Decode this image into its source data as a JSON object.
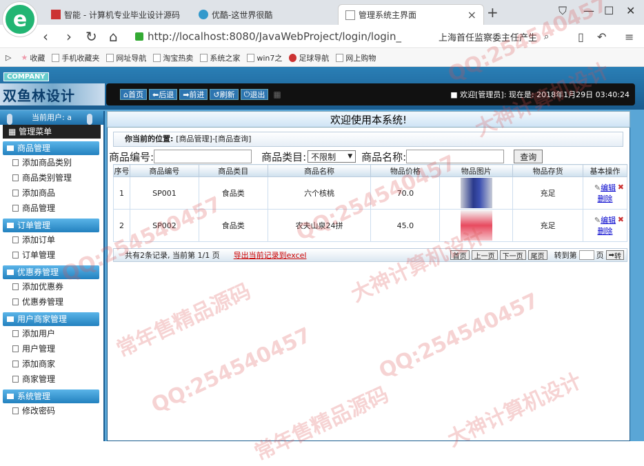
{
  "browser": {
    "tabs": [
      {
        "title": "智能 - 计算机专业毕业设计源码"
      },
      {
        "title": "优酷-这世界很酷"
      },
      {
        "title": "管理系统主界面"
      }
    ],
    "url": "http://localhost:8080/JavaWebProject/login/login_",
    "search_text": "上海首任监察委主任产生",
    "bookmarks": [
      "收藏",
      "手机收藏夹",
      "网址导航",
      "淘宝热卖",
      "系统之家",
      "win7之",
      "足球导航",
      "网上购物"
    ]
  },
  "header": {
    "company": "COMPANY",
    "brand": "双鱼林设计",
    "buttons": [
      "首页",
      "后退",
      "前进",
      "刷新",
      "退出"
    ],
    "welcome": "欢迎[管理员]:   现在是: 2018年1月29日 03:40:24"
  },
  "sidebar": {
    "current_user": "当前用户: a",
    "menu_title": "管理菜单",
    "groups": [
      {
        "title": "商品管理",
        "items": [
          "添加商品类别",
          "商品类别管理",
          "添加商品",
          "商品管理"
        ]
      },
      {
        "title": "订单管理",
        "items": [
          "添加订单",
          "订单管理"
        ]
      },
      {
        "title": "优惠券管理",
        "items": [
          "添加优惠券",
          "优惠券管理"
        ]
      },
      {
        "title": "用户商家管理",
        "items": [
          "添加用户",
          "用户管理",
          "添加商家",
          "商家管理"
        ]
      },
      {
        "title": "系统管理",
        "items": [
          "修改密码"
        ]
      }
    ]
  },
  "main": {
    "welcome": "欢迎使用本系统!",
    "location_label": "你当前的位置:",
    "location_value": "[商品管理]-[商品查询]",
    "filter": {
      "code_label": "商品编号:",
      "type_label": "商品类目:",
      "type_value": "不限制",
      "name_label": "商品名称:",
      "query": "查询"
    },
    "table": {
      "headers": [
        "序号",
        "商品编号",
        "商品类目",
        "商品名称",
        "物品价格",
        "物品图片",
        "物品存货",
        "基本操作"
      ],
      "rows": [
        {
          "no": "1",
          "code": "SP001",
          "type": "食品类",
          "name": "六个核桃",
          "price": "70.0",
          "stock": "充足",
          "edit": "编辑",
          "del": "删除"
        },
        {
          "no": "2",
          "code": "SP002",
          "type": "食品类",
          "name": "农夫山泉24拼",
          "price": "45.0",
          "stock": "充足",
          "edit": "编辑",
          "del": "删除"
        }
      ]
    },
    "footer": {
      "summary": "共有2条记录, 当前第 1/1 页",
      "export": "导出当前记录到excel",
      "first": "首页",
      "prev": "上一页",
      "next": "下一页",
      "last": "尾页",
      "goto": "转到第",
      "page_unit": "页",
      "go": "转"
    }
  },
  "watermarks": [
    "QQ:254540457",
    "常年售精品源码",
    "大神计算机设计"
  ]
}
